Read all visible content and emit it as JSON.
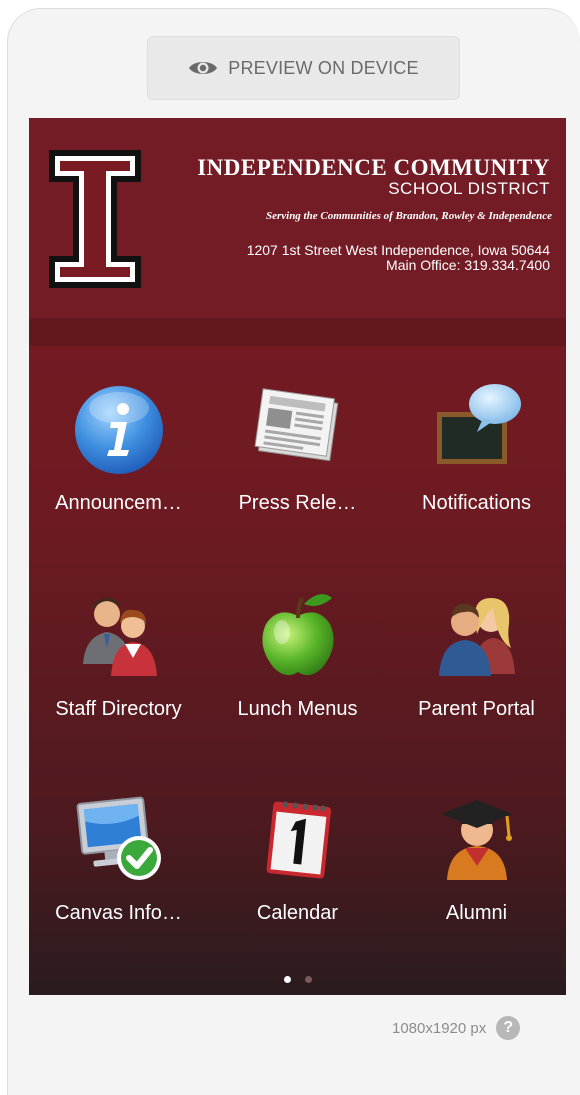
{
  "preview": {
    "label": "PREVIEW ON DEVICE",
    "icon": "eye-icon"
  },
  "header": {
    "name_line1": "INDEPENDENCE COMMUNITY",
    "name_line2": "SCHOOL DISTRICT",
    "tagline": "Serving the Communities of Brandon, Rowley & Independence",
    "address": "1207 1st Street West Independence, Iowa 50644",
    "office": "Main Office: 319.334.7400",
    "logo_letter": "I",
    "colors": {
      "maroon": "#741c26",
      "band": "#631820"
    }
  },
  "tiles": [
    {
      "label": "Announcem…",
      "icon": "info-icon"
    },
    {
      "label": "Press Rele…",
      "icon": "newspaper-icon"
    },
    {
      "label": "Notifications",
      "icon": "chalkboard-bubble-icon"
    },
    {
      "label": "Staff Directory",
      "icon": "staff-people-icon"
    },
    {
      "label": "Lunch Menus",
      "icon": "apple-icon"
    },
    {
      "label": "Parent Portal",
      "icon": "parents-icon"
    },
    {
      "label": "Canvas Info…",
      "icon": "computer-check-icon"
    },
    {
      "label": "Calendar",
      "icon": "calendar-icon"
    },
    {
      "label": "Alumni",
      "icon": "graduate-icon"
    }
  ],
  "pager": {
    "pages": 2,
    "current": 1
  },
  "footer": {
    "resolution": "1080x1920 px",
    "help": "?"
  }
}
